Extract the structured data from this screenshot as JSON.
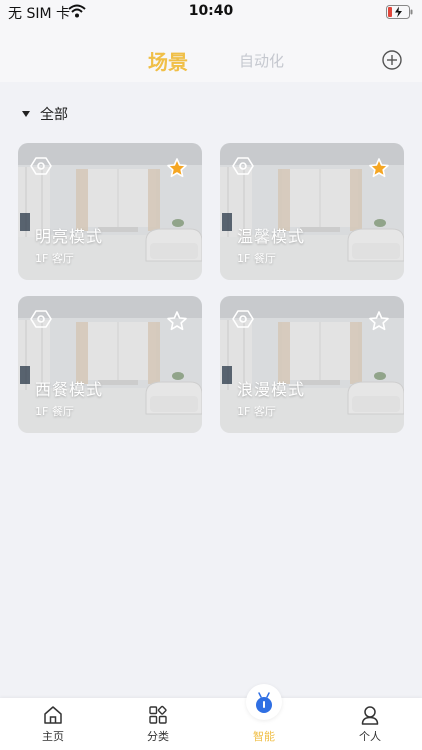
{
  "status_bar": {
    "carrier": "无 SIM 卡",
    "time": "10:40"
  },
  "header": {
    "tabs": [
      {
        "label": "场景",
        "active": true
      },
      {
        "label": "自动化",
        "active": false
      }
    ],
    "add_icon": "plus-circle-icon"
  },
  "group": {
    "label": "全部",
    "expanded": true
  },
  "scenes": [
    {
      "name": "明亮模式",
      "location": "1F  客厅",
      "favorite": true
    },
    {
      "name": "温馨模式",
      "location": "1F  餐厅",
      "favorite": true
    },
    {
      "name": "西餐模式",
      "location": "1F  餐厅",
      "favorite": false
    },
    {
      "name": "浪漫模式",
      "location": "1F  客厅",
      "favorite": false
    }
  ],
  "bottom_nav": [
    {
      "label": "主页",
      "icon": "home-icon",
      "active": false
    },
    {
      "label": "分类",
      "icon": "category-grid-icon",
      "active": false
    },
    {
      "label": "智能",
      "icon": "smart-robot-icon",
      "active": true
    },
    {
      "label": "个人",
      "icon": "person-icon",
      "active": false
    }
  ],
  "colors": {
    "accent": "#f0bf47",
    "inactive_tab": "#c5c8cf",
    "background": "#f1f2f6",
    "favorite_star": "#f5a623"
  }
}
